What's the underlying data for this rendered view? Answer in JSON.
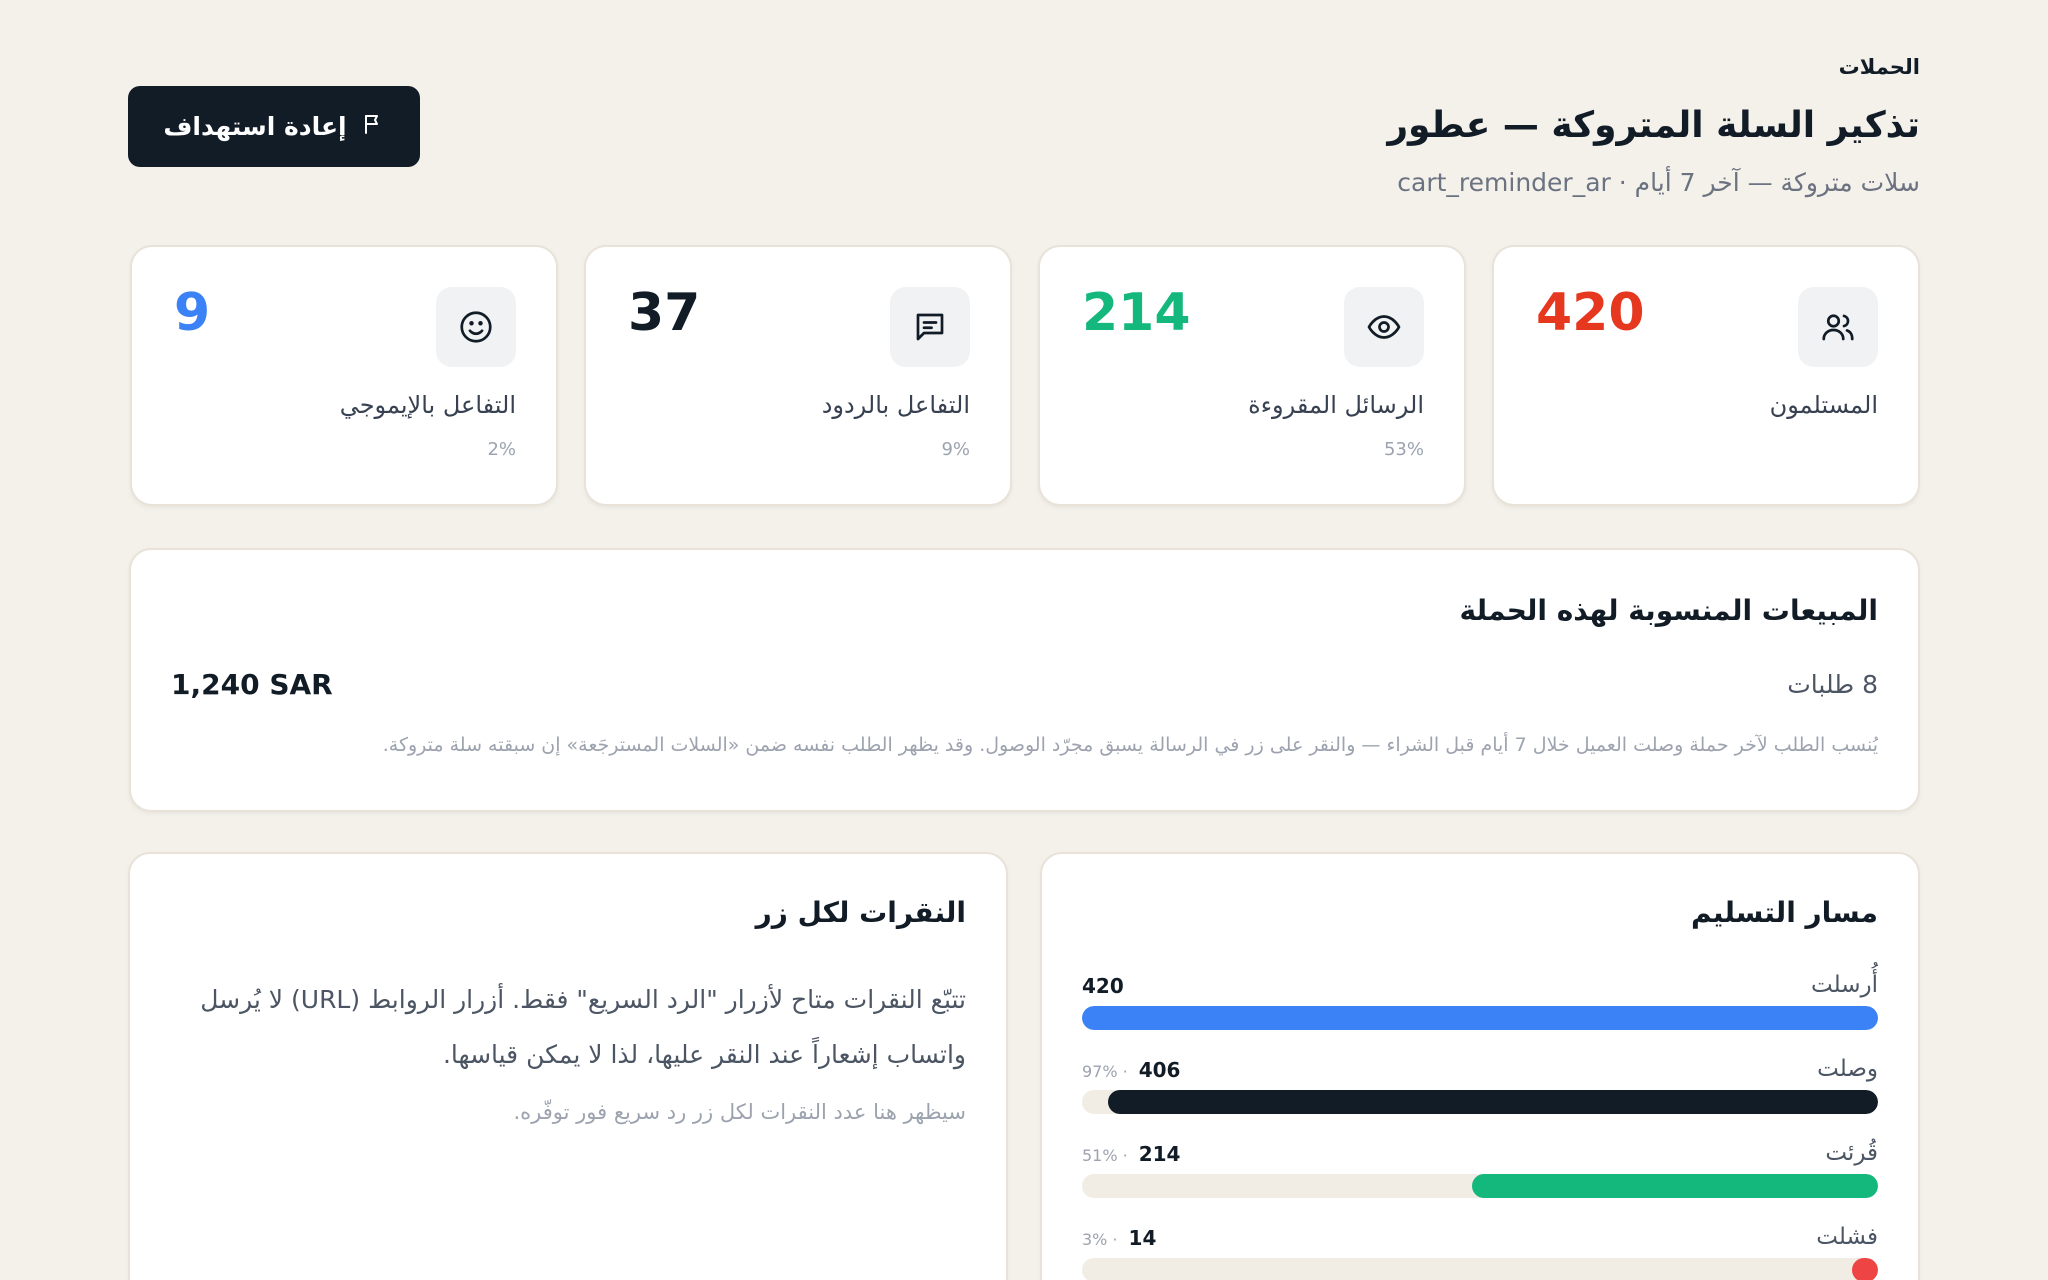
{
  "header": {
    "breadcrumb": "الحملات",
    "title": "تذكير السلة المتروكة — عطور",
    "subtitle": "سلات متروكة — آخر 7 أيام · cart_reminder_ar",
    "retarget_label": "إعادة استهداف"
  },
  "stats": [
    {
      "label": "المستلمون",
      "value": "420",
      "pct": "",
      "color": "#e5381f",
      "icon": "users-icon"
    },
    {
      "label": "الرسائل المقروءة",
      "value": "214",
      "pct": "53%",
      "color": "#14b87c",
      "icon": "eye-icon"
    },
    {
      "label": "التفاعل بالردود",
      "value": "37",
      "pct": "9%",
      "color": "#111c27",
      "icon": "chat-icon"
    },
    {
      "label": "التفاعل بالإيموجي",
      "value": "9",
      "pct": "2%",
      "color": "#3b82f6",
      "icon": "smile-icon"
    }
  ],
  "sales": {
    "title": "المبيعات المنسوبة لهذه الحملة",
    "orders": "8 طلبات",
    "amount": "1,240 SAR",
    "note": "يُنسب الطلب لآخر حملة وصلت العميل خلال 7 أيام قبل الشراء — والنقر على زر في الرسالة يسبق مجرّد الوصول. وقد يظهر الطلب نفسه ضمن «السلات المسترجَعة» إن سبقته سلة متروكة."
  },
  "clicks": {
    "title": "النقرات لكل زر",
    "description": "تتبّع النقرات متاح لأزرار \"الرد السريع\" فقط. أزرار الروابط (URL) لا يُرسل واتساب إشعاراً عند النقر عليها، لذا لا يمكن قياسها.",
    "hint": "سيظهر هنا عدد النقرات لكل زر رد سريع فور توفّره."
  },
  "delivery": {
    "title": "مسار التسليم",
    "rows": [
      {
        "label": "أُرسلت",
        "count": "420",
        "pct": "",
        "fraction": 1.0,
        "color": "#3b82f6"
      },
      {
        "label": "وصلت",
        "count": "406",
        "pct": "97%",
        "fraction": 0.967,
        "color": "#111c27"
      },
      {
        "label": "قُرئت",
        "count": "214",
        "pct": "51%",
        "fraction": 0.51,
        "color": "#14b87c"
      },
      {
        "label": "فشلت",
        "count": "14",
        "pct": "3%",
        "fraction": 0.033,
        "color": "#ef4444"
      }
    ]
  }
}
